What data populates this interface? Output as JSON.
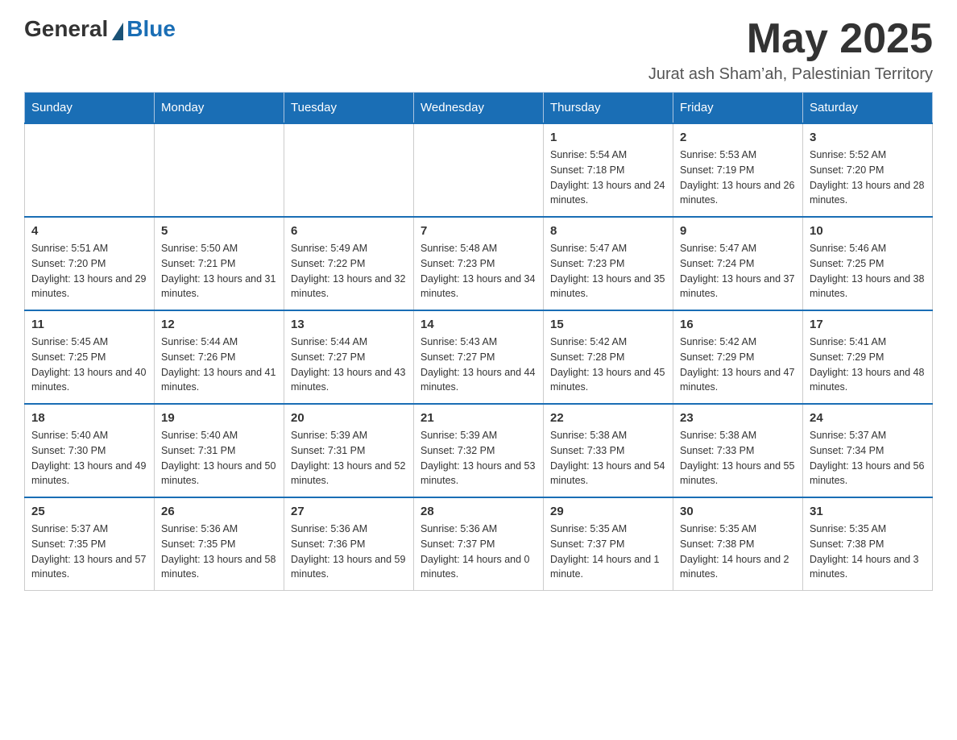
{
  "header": {
    "logo_general": "General",
    "logo_blue": "Blue",
    "month_year": "May 2025",
    "location": "Jurat ash Sham’ah, Palestinian Territory"
  },
  "weekdays": [
    "Sunday",
    "Monday",
    "Tuesday",
    "Wednesday",
    "Thursday",
    "Friday",
    "Saturday"
  ],
  "weeks": [
    [
      {
        "day": "",
        "info": ""
      },
      {
        "day": "",
        "info": ""
      },
      {
        "day": "",
        "info": ""
      },
      {
        "day": "",
        "info": ""
      },
      {
        "day": "1",
        "info": "Sunrise: 5:54 AM\nSunset: 7:18 PM\nDaylight: 13 hours and 24 minutes."
      },
      {
        "day": "2",
        "info": "Sunrise: 5:53 AM\nSunset: 7:19 PM\nDaylight: 13 hours and 26 minutes."
      },
      {
        "day": "3",
        "info": "Sunrise: 5:52 AM\nSunset: 7:20 PM\nDaylight: 13 hours and 28 minutes."
      }
    ],
    [
      {
        "day": "4",
        "info": "Sunrise: 5:51 AM\nSunset: 7:20 PM\nDaylight: 13 hours and 29 minutes."
      },
      {
        "day": "5",
        "info": "Sunrise: 5:50 AM\nSunset: 7:21 PM\nDaylight: 13 hours and 31 minutes."
      },
      {
        "day": "6",
        "info": "Sunrise: 5:49 AM\nSunset: 7:22 PM\nDaylight: 13 hours and 32 minutes."
      },
      {
        "day": "7",
        "info": "Sunrise: 5:48 AM\nSunset: 7:23 PM\nDaylight: 13 hours and 34 minutes."
      },
      {
        "day": "8",
        "info": "Sunrise: 5:47 AM\nSunset: 7:23 PM\nDaylight: 13 hours and 35 minutes."
      },
      {
        "day": "9",
        "info": "Sunrise: 5:47 AM\nSunset: 7:24 PM\nDaylight: 13 hours and 37 minutes."
      },
      {
        "day": "10",
        "info": "Sunrise: 5:46 AM\nSunset: 7:25 PM\nDaylight: 13 hours and 38 minutes."
      }
    ],
    [
      {
        "day": "11",
        "info": "Sunrise: 5:45 AM\nSunset: 7:25 PM\nDaylight: 13 hours and 40 minutes."
      },
      {
        "day": "12",
        "info": "Sunrise: 5:44 AM\nSunset: 7:26 PM\nDaylight: 13 hours and 41 minutes."
      },
      {
        "day": "13",
        "info": "Sunrise: 5:44 AM\nSunset: 7:27 PM\nDaylight: 13 hours and 43 minutes."
      },
      {
        "day": "14",
        "info": "Sunrise: 5:43 AM\nSunset: 7:27 PM\nDaylight: 13 hours and 44 minutes."
      },
      {
        "day": "15",
        "info": "Sunrise: 5:42 AM\nSunset: 7:28 PM\nDaylight: 13 hours and 45 minutes."
      },
      {
        "day": "16",
        "info": "Sunrise: 5:42 AM\nSunset: 7:29 PM\nDaylight: 13 hours and 47 minutes."
      },
      {
        "day": "17",
        "info": "Sunrise: 5:41 AM\nSunset: 7:29 PM\nDaylight: 13 hours and 48 minutes."
      }
    ],
    [
      {
        "day": "18",
        "info": "Sunrise: 5:40 AM\nSunset: 7:30 PM\nDaylight: 13 hours and 49 minutes."
      },
      {
        "day": "19",
        "info": "Sunrise: 5:40 AM\nSunset: 7:31 PM\nDaylight: 13 hours and 50 minutes."
      },
      {
        "day": "20",
        "info": "Sunrise: 5:39 AM\nSunset: 7:31 PM\nDaylight: 13 hours and 52 minutes."
      },
      {
        "day": "21",
        "info": "Sunrise: 5:39 AM\nSunset: 7:32 PM\nDaylight: 13 hours and 53 minutes."
      },
      {
        "day": "22",
        "info": "Sunrise: 5:38 AM\nSunset: 7:33 PM\nDaylight: 13 hours and 54 minutes."
      },
      {
        "day": "23",
        "info": "Sunrise: 5:38 AM\nSunset: 7:33 PM\nDaylight: 13 hours and 55 minutes."
      },
      {
        "day": "24",
        "info": "Sunrise: 5:37 AM\nSunset: 7:34 PM\nDaylight: 13 hours and 56 minutes."
      }
    ],
    [
      {
        "day": "25",
        "info": "Sunrise: 5:37 AM\nSunset: 7:35 PM\nDaylight: 13 hours and 57 minutes."
      },
      {
        "day": "26",
        "info": "Sunrise: 5:36 AM\nSunset: 7:35 PM\nDaylight: 13 hours and 58 minutes."
      },
      {
        "day": "27",
        "info": "Sunrise: 5:36 AM\nSunset: 7:36 PM\nDaylight: 13 hours and 59 minutes."
      },
      {
        "day": "28",
        "info": "Sunrise: 5:36 AM\nSunset: 7:37 PM\nDaylight: 14 hours and 0 minutes."
      },
      {
        "day": "29",
        "info": "Sunrise: 5:35 AM\nSunset: 7:37 PM\nDaylight: 14 hours and 1 minute."
      },
      {
        "day": "30",
        "info": "Sunrise: 5:35 AM\nSunset: 7:38 PM\nDaylight: 14 hours and 2 minutes."
      },
      {
        "day": "31",
        "info": "Sunrise: 5:35 AM\nSunset: 7:38 PM\nDaylight: 14 hours and 3 minutes."
      }
    ]
  ]
}
